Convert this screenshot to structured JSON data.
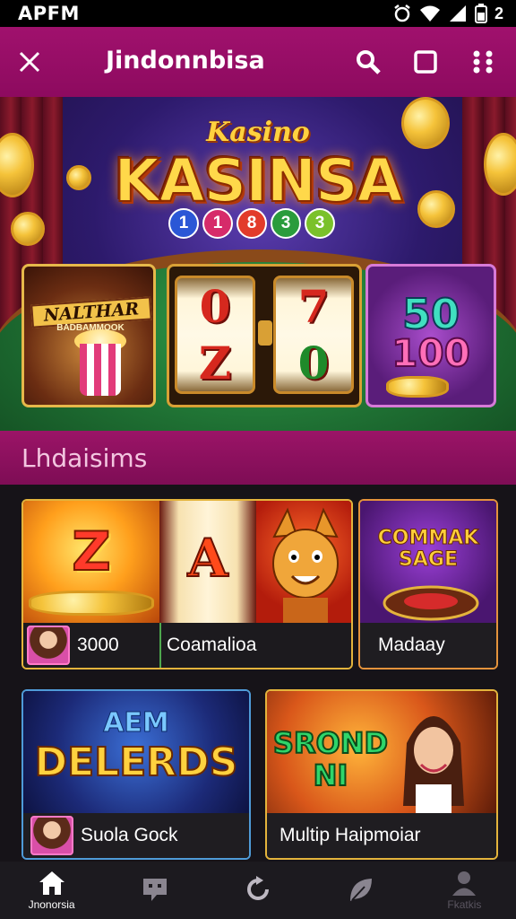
{
  "status_bar": {
    "time": "APFM",
    "battery_text": "2"
  },
  "app_bar": {
    "title": "Jindonnbisa",
    "actions": [
      "search-icon",
      "window-icon",
      "more-options-icon"
    ]
  },
  "hero": {
    "logo_small": "Kasino",
    "logo": "KASINSA",
    "balls": [
      "1",
      "1",
      "8",
      "3",
      "3"
    ],
    "panel_left_title": "NALTHAR",
    "panel_left_sub": "BADBAMMOOK",
    "reels": [
      {
        "top": "0",
        "bottom": "Z"
      },
      {
        "top": "7",
        "bottom": "0"
      }
    ],
    "panel_right_top": "50",
    "panel_right_bottom": "100"
  },
  "section": {
    "title": "Lhdaisims"
  },
  "games": [
    {
      "art_text": "Z",
      "caption": "3000"
    },
    {
      "art_text": "A",
      "caption": "Coamalioa"
    },
    {
      "art_text": "COMMAK SAGE",
      "caption": "Madaay"
    },
    {
      "art_text": "DELERDS",
      "art_sub": "AEM",
      "caption": "Suola Gock"
    },
    {
      "art_text": "SROND NI",
      "caption": "Multip Haipmoiar"
    }
  ],
  "bottom_nav": [
    {
      "label": "Jnonorsia",
      "icon": "home-icon",
      "active": true
    },
    {
      "label": "",
      "icon": "chat-icon",
      "active": false
    },
    {
      "label": "",
      "icon": "refresh-icon",
      "active": false
    },
    {
      "label": "",
      "icon": "leaf-icon",
      "active": false
    },
    {
      "label": "Fkatkis",
      "icon": "profile-icon",
      "active": false
    }
  ],
  "colors": {
    "brand": "#9b1467",
    "accent_gold": "#e4b43c",
    "background": "#141218"
  }
}
